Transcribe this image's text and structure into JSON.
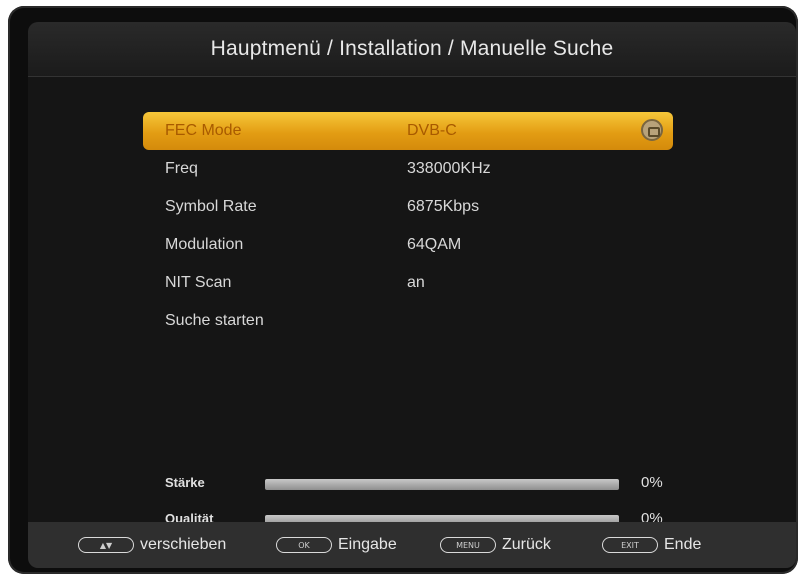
{
  "header": {
    "title": "Hauptmenü / Installation / Manuelle Suche"
  },
  "menu": {
    "items": [
      {
        "label": "FEC Mode",
        "value": "DVB-C",
        "selected": true
      },
      {
        "label": "Freq",
        "value": "338000KHz"
      },
      {
        "label": "Symbol Rate",
        "value": "6875Kbps"
      },
      {
        "label": "Modulation",
        "value": "64QAM"
      },
      {
        "label": "NIT Scan",
        "value": "an"
      },
      {
        "label": "Suche starten",
        "value": ""
      }
    ]
  },
  "signal": {
    "strength": {
      "label": "Stärke",
      "percent_text": "0%",
      "level": 0
    },
    "quality": {
      "label": "Qualität",
      "percent_text": "0%",
      "level": 0
    }
  },
  "footer": {
    "hints": [
      {
        "key": "▲▼",
        "label": "verschieben"
      },
      {
        "key": "OK",
        "label": "Eingabe"
      },
      {
        "key": "MENU",
        "label": "Zurück"
      },
      {
        "key": "EXIT",
        "label": "Ende"
      }
    ]
  },
  "colors": {
    "selection": "#f2b42a",
    "background": "#151515",
    "footer": "#2f2f2f"
  },
  "icons": {
    "selected_row": "edit-icon"
  }
}
